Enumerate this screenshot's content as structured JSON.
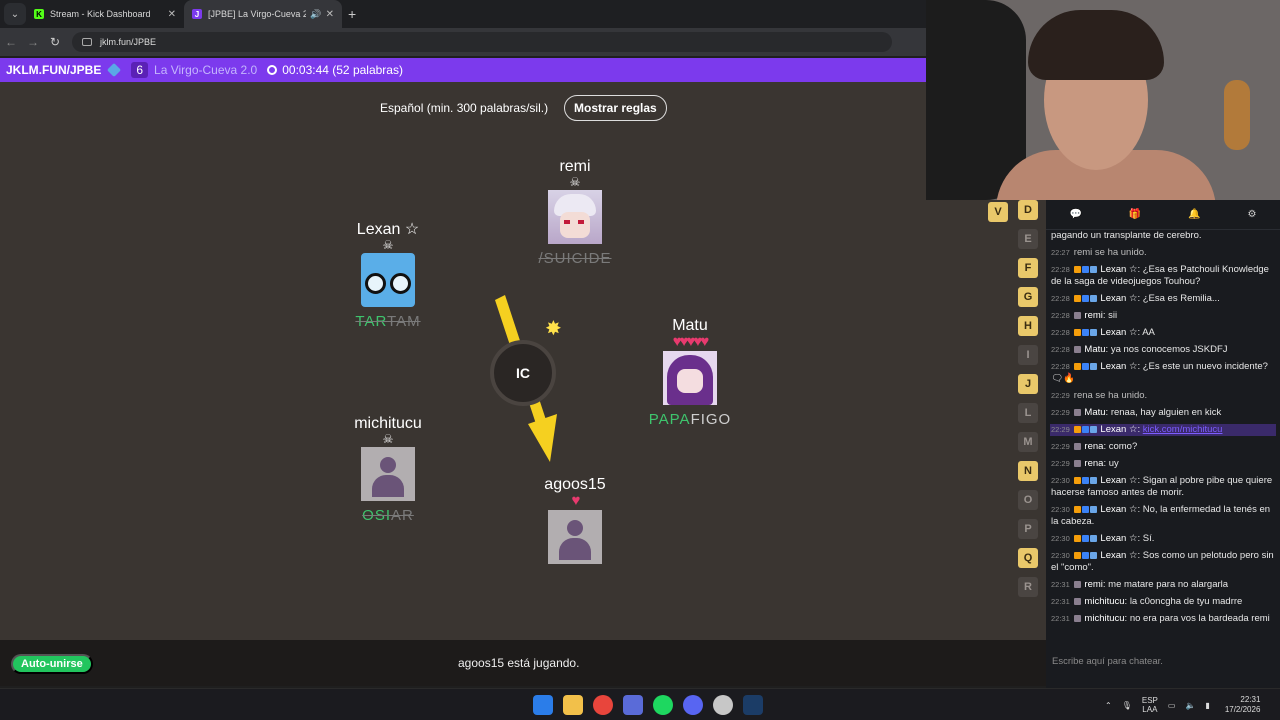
{
  "browser": {
    "tabs": [
      {
        "icon": "K",
        "title": "Stream - Kick Dashboard",
        "icon_color": "#53fc18"
      },
      {
        "icon": "J",
        "title": "[JPBE] La Virgo-Cueva 2.0",
        "icon_color": "#7c3aed"
      }
    ],
    "url": "jklm.fun/JPBE"
  },
  "game_header": {
    "room_code": "JKLM.FUN/JPBE",
    "player_count": "6",
    "room_name": "La Virgo-Cueva 2.0",
    "timer": "00:03:44 (52 palabras)"
  },
  "game": {
    "rules_text": "Español (min. 300 palabras/sil.)",
    "rules_button": "Mostrar reglas",
    "syllable": "IC",
    "players": {
      "remi": {
        "name": "remi",
        "word_green": "",
        "word_rest": "/SUICIDE"
      },
      "lexan": {
        "name": "Lexan ☆",
        "word_green": "TAR",
        "word_rest": "TAM"
      },
      "matu": {
        "name": "Matu",
        "hearts": "♥♥♥♥♥",
        "word_green": "PAPA",
        "word_rest": "FIGO"
      },
      "michitucu": {
        "name": "michitucu",
        "word_green": "OSI",
        "word_rest": "AR"
      },
      "agoos": {
        "name": "agoos15",
        "hearts": "♥"
      }
    },
    "auto_join": "Auto-unirse",
    "status": "agoos15 está jugando."
  },
  "letters": {
    "v": "V",
    "list": [
      {
        "l": "D",
        "on": true
      },
      {
        "l": "E",
        "on": false
      },
      {
        "l": "F",
        "on": true
      },
      {
        "l": "G",
        "on": true
      },
      {
        "l": "H",
        "on": true
      },
      {
        "l": "I",
        "on": false
      },
      {
        "l": "J",
        "on": true
      },
      {
        "l": "L",
        "on": false
      },
      {
        "l": "M",
        "on": false
      },
      {
        "l": "N",
        "on": true
      },
      {
        "l": "O",
        "on": false
      },
      {
        "l": "P",
        "on": false
      },
      {
        "l": "Q",
        "on": true
      },
      {
        "l": "R",
        "on": false
      }
    ]
  },
  "chat": {
    "messages": [
      {
        "time": "",
        "user": "",
        "text": "pagando un transplante de cerebro.",
        "type": "cont"
      },
      {
        "time": "22:27",
        "user": "",
        "text": "remi se ha unido.",
        "type": "sys"
      },
      {
        "time": "22:28",
        "user": "Lexan ☆",
        "text": ": ¿Esa es Patchouli Knowledge de la saga de videojuegos Touhou?",
        "type": "msg"
      },
      {
        "time": "22:28",
        "user": "Lexan ☆",
        "text": ": ¿Esa es Remilia...",
        "type": "msg"
      },
      {
        "time": "22:28",
        "user": "remi",
        "text": ": sii",
        "type": "msg"
      },
      {
        "time": "22:28",
        "user": "Lexan ☆",
        "text": ": AA",
        "type": "msg"
      },
      {
        "time": "22:28",
        "user": "Matu",
        "text": ": ya nos conocemos JSKDFJ",
        "type": "msg"
      },
      {
        "time": "22:28",
        "user": "Lexan ☆",
        "text": ": ¿Es este un nuevo incidente? 🗨🔥",
        "type": "msg"
      },
      {
        "time": "22:29",
        "user": "",
        "text": "rena se ha unido.",
        "type": "sys"
      },
      {
        "time": "22:29",
        "user": "Matu",
        "text": ": renaa, hay alguien en kick",
        "type": "msg"
      },
      {
        "time": "22:29",
        "user": "Lexan ☆",
        "text": ": ",
        "link": "kick.com/michitucu",
        "type": "hl"
      },
      {
        "time": "22:29",
        "user": "rena",
        "text": ": como?",
        "type": "msg"
      },
      {
        "time": "22:29",
        "user": "rena",
        "text": ": uy",
        "type": "msg"
      },
      {
        "time": "22:30",
        "user": "Lexan ☆",
        "text": ": Sigan al pobre pibe que quiere hacerse famoso antes de morir.",
        "type": "msg"
      },
      {
        "time": "22:30",
        "user": "Lexan ☆",
        "text": ": No, la enfermedad la tenés en la cabeza.",
        "type": "msg"
      },
      {
        "time": "22:30",
        "user": "Lexan ☆",
        "text": ": Sí.",
        "type": "msg"
      },
      {
        "time": "22:30",
        "user": "Lexan ☆",
        "text": ": Sos como un pelotudo pero sin el \"como\".",
        "type": "msg"
      },
      {
        "time": "22:31",
        "user": "remi",
        "text": ": me matare para no alargarla",
        "type": "msg"
      },
      {
        "time": "22:31",
        "user": "michitucu",
        "text": ": la c0oncgha de tyu madrre",
        "type": "msg"
      },
      {
        "time": "22:31",
        "user": "michitucu",
        "text": ": no era para vos la bardeada remi",
        "type": "msg"
      }
    ],
    "input_placeholder": "Escribe aquí para chatear."
  },
  "taskbar": {
    "lang": "ESP",
    "lang2": "LAA",
    "time": "22:31",
    "date": "17/2/2026"
  },
  "colors": {
    "accent": "#7c3aed",
    "green": "#3ec46d",
    "letter_on": "#e9c86a"
  }
}
